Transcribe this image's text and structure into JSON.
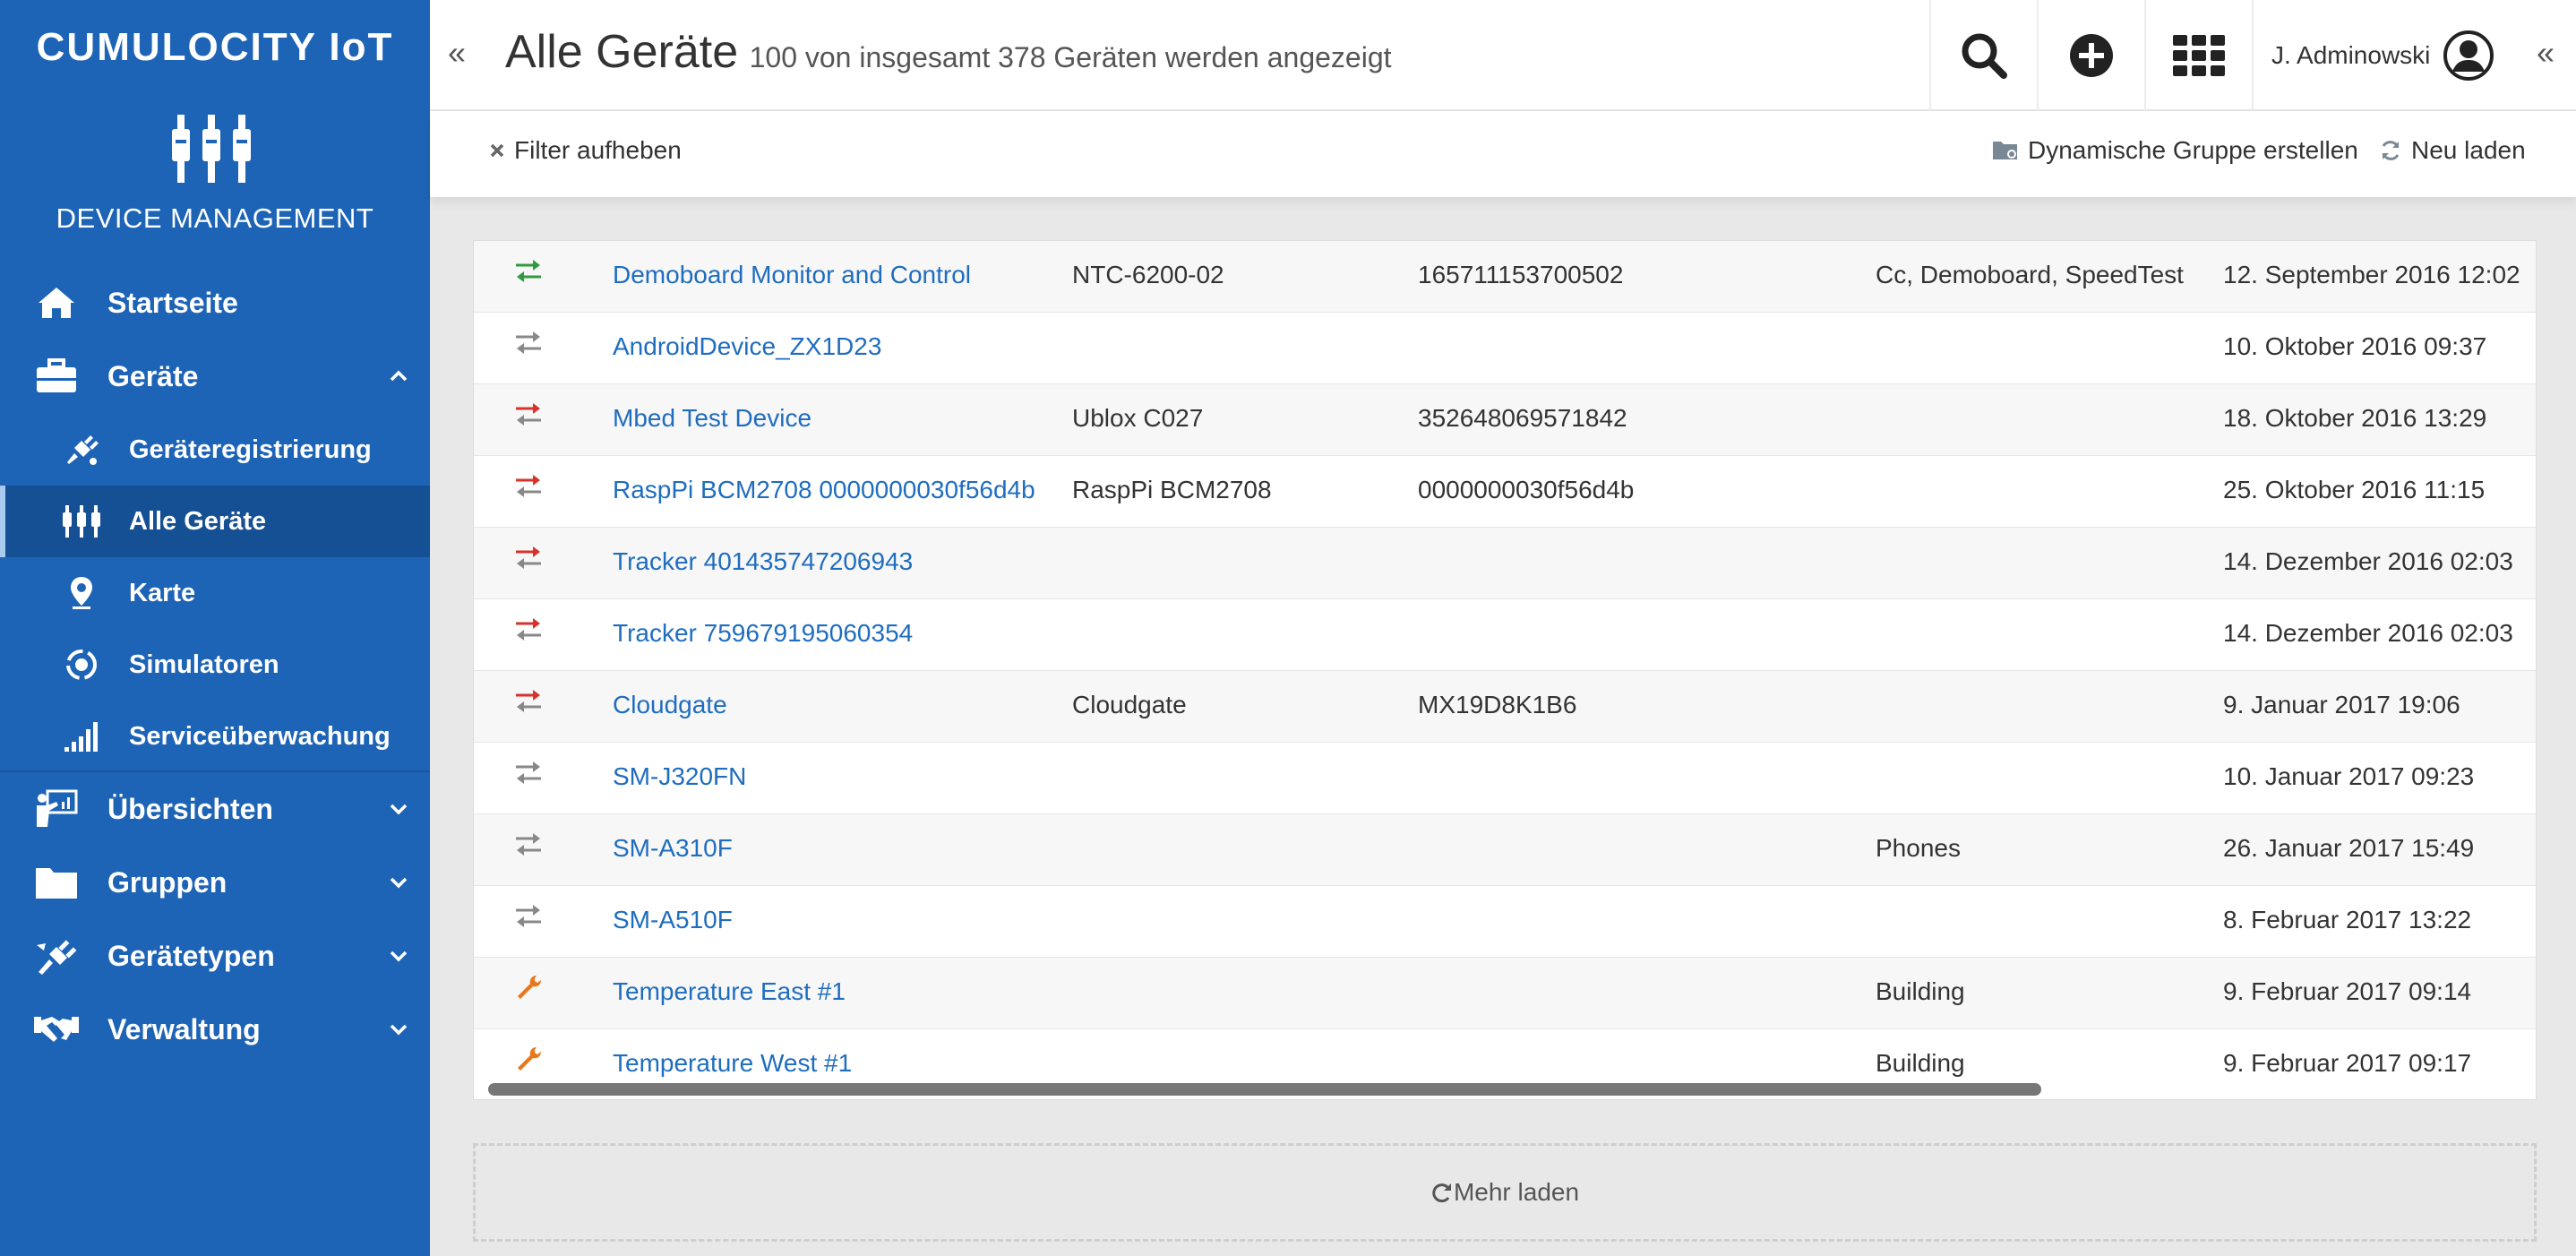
{
  "sidebar": {
    "brand": "CUMULOCITY IoT",
    "app_name": "DEVICE MANAGEMENT",
    "nav": {
      "home": "Startseite",
      "devices": "Geräte",
      "device_registration": "Geräteregistrierung",
      "all_devices": "Alle Geräte",
      "map": "Karte",
      "simulators": "Simulatoren",
      "service_monitoring": "Serviceüberwachung",
      "overviews": "Übersichten",
      "groups": "Gruppen",
      "device_types": "Gerätetypen",
      "management": "Verwaltung"
    }
  },
  "header": {
    "title": "Alle Geräte",
    "subtitle": "100 von insgesamt 378 Geräten werden angezeigt",
    "user_name": "J. Adminowski"
  },
  "actions": {
    "clear_filter": "Filter aufheben",
    "create_dynamic_group": "Dynamische Gruppe erstellen",
    "reload": "Neu laden"
  },
  "colors": {
    "sidebar": "#1e64b6",
    "link": "#1f6dbf",
    "status_online": "#2e9b3e",
    "status_offline": "#d9322b",
    "status_unknown": "#888888",
    "maintenance": "#e8781a"
  },
  "devices": [
    {
      "status": "online",
      "name": "Demoboard Monitor and Control",
      "model": "NTC-6200-02",
      "serial": "165711153700502",
      "groups": "Cc, Demoboard, SpeedTest",
      "registered": "12. September 2016 12:02"
    },
    {
      "status": "unknown",
      "name": "AndroidDevice_ZX1D23",
      "model": "",
      "serial": "",
      "groups": "",
      "registered": "10. Oktober 2016 09:37"
    },
    {
      "status": "offline",
      "name": "Mbed Test Device",
      "model": "Ublox C027",
      "serial": "352648069571842",
      "groups": "",
      "registered": "18. Oktober 2016 13:29"
    },
    {
      "status": "offline",
      "name": "RaspPi BCM2708 0000000030f56d4b",
      "model": "RaspPi BCM2708",
      "serial": "0000000030f56d4b",
      "groups": "",
      "registered": "25. Oktober 2016 11:15"
    },
    {
      "status": "offline",
      "name": "Tracker 401435747206943",
      "model": "",
      "serial": "",
      "groups": "",
      "registered": "14. Dezember 2016 02:03"
    },
    {
      "status": "offline",
      "name": "Tracker 759679195060354",
      "model": "",
      "serial": "",
      "groups": "",
      "registered": "14. Dezember 2016 02:03"
    },
    {
      "status": "offline",
      "name": "Cloudgate",
      "model": "Cloudgate",
      "serial": "MX19D8K1B6",
      "groups": "",
      "registered": "9. Januar 2017 19:06"
    },
    {
      "status": "unknown",
      "name": "SM-J320FN",
      "model": "",
      "serial": "",
      "groups": "",
      "registered": "10. Januar 2017 09:23"
    },
    {
      "status": "unknown",
      "name": "SM-A310F",
      "model": "",
      "serial": "",
      "groups": "Phones",
      "registered": "26. Januar 2017 15:49"
    },
    {
      "status": "unknown",
      "name": "SM-A510F",
      "model": "",
      "serial": "",
      "groups": "",
      "registered": "8. Februar 2017 13:22"
    },
    {
      "status": "maintenance",
      "name": "Temperature East #1",
      "model": "",
      "serial": "",
      "groups": "Building",
      "registered": "9. Februar 2017 09:14"
    },
    {
      "status": "maintenance",
      "name": "Temperature West #1",
      "model": "",
      "serial": "",
      "groups": "Building",
      "registered": "9. Februar 2017 09:17"
    }
  ],
  "load_more": "Mehr laden"
}
